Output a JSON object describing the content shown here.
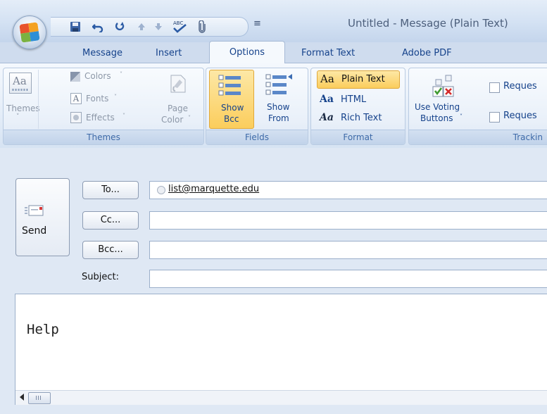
{
  "window": {
    "title": "Untitled - Message (Plain Text)"
  },
  "quick_access": [
    "save-icon",
    "undo-icon",
    "redo-icon",
    "up-arrow-icon",
    "down-arrow-icon",
    "spelling-icon",
    "attach-icon"
  ],
  "qat_more": "≡",
  "tabs": [
    "Message",
    "Insert",
    "Options",
    "Format Text",
    "Adobe PDF"
  ],
  "active_tab": "Options",
  "ribbon": {
    "themes": {
      "label": "Themes",
      "themes_button": "Themes",
      "colors": "Colors",
      "fonts": "Fonts",
      "effects": "Effects",
      "page_color_1": "Page",
      "page_color_2": "Color",
      "dropdown": "˅"
    },
    "fields": {
      "label": "Fields",
      "show_bcc_1": "Show",
      "show_bcc_2": "Bcc",
      "show_from_1": "Show",
      "show_from_2": "From"
    },
    "format": {
      "label": "Format",
      "plain_text": "Plain Text",
      "html": "HTML",
      "rich_text": "Rich Text",
      "icon_text": "Aa"
    },
    "tracking": {
      "label": "Trackin",
      "voting_1": "Use Voting",
      "voting_2": "Buttons",
      "request_1": "Reques",
      "request_2": "Reques"
    }
  },
  "compose": {
    "send": "Send",
    "to_button": "To...",
    "cc_button": "Cc...",
    "bcc_button": "Bcc...",
    "subject_label": "Subject:",
    "to_value": "list@marquette.edu",
    "cc_value": "",
    "bcc_value": "",
    "subject_value": "",
    "body": "Help"
  },
  "colors": {
    "accent": "#15428b",
    "selected_bg": "#fbcd5c"
  }
}
